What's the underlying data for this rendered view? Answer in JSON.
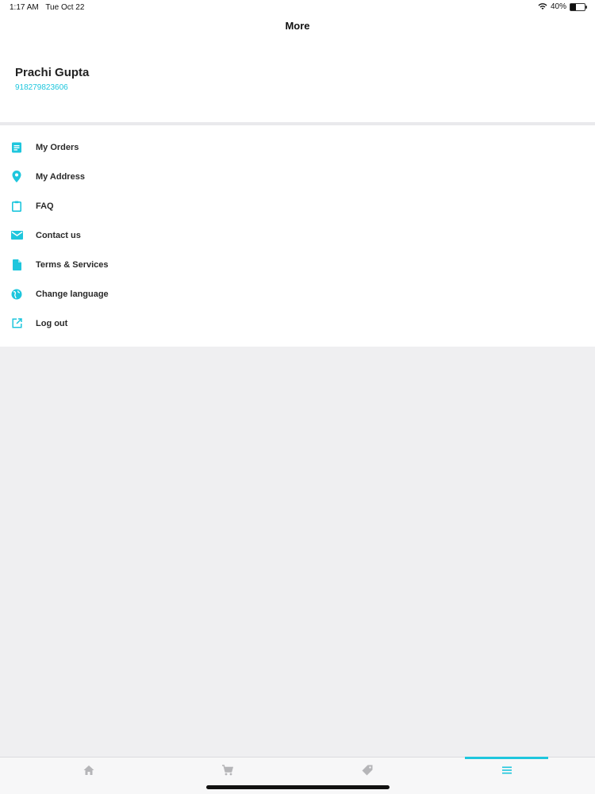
{
  "status_bar": {
    "time": "1:17 AM",
    "date": "Tue Oct 22",
    "battery": "40%",
    "battery_level": 0.4
  },
  "header": {
    "title": "More"
  },
  "profile": {
    "name": "Prachi Gupta",
    "phone": "918279823606"
  },
  "menu": {
    "items": [
      {
        "label": "My Orders",
        "icon": "orders-icon"
      },
      {
        "label": "My Address",
        "icon": "location-pin-icon"
      },
      {
        "label": "FAQ",
        "icon": "clipboard-icon"
      },
      {
        "label": "Contact us",
        "icon": "mail-icon"
      },
      {
        "label": "Terms & Services",
        "icon": "document-icon"
      },
      {
        "label": "Change language",
        "icon": "globe-icon"
      },
      {
        "label": "Log out",
        "icon": "external-link-icon"
      }
    ]
  },
  "tab_bar": {
    "tabs": [
      {
        "name": "home",
        "icon": "home-icon",
        "active": false
      },
      {
        "name": "cart",
        "icon": "cart-icon",
        "active": false
      },
      {
        "name": "offers",
        "icon": "tag-icon",
        "active": false
      },
      {
        "name": "more",
        "icon": "menu-icon",
        "active": true
      }
    ]
  },
  "colors": {
    "accent": "#1ec6dd",
    "inactive_icon": "#b5b5b8",
    "background": "#efeff1"
  }
}
